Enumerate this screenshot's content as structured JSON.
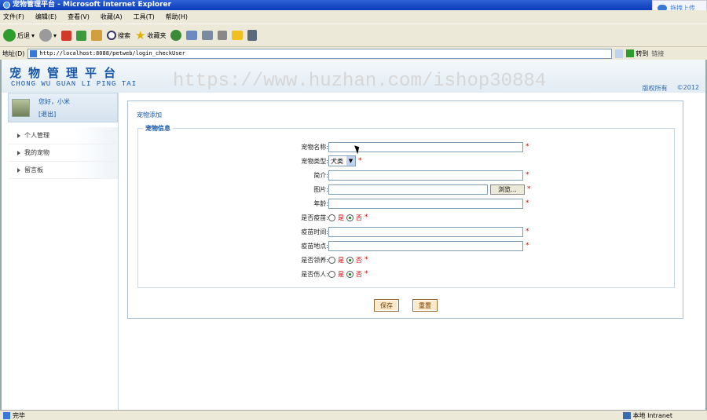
{
  "window": {
    "title": "宠物管理平台 - Microsoft Internet Explorer",
    "status": "完毕",
    "zone": "本地 Intranet"
  },
  "menu": [
    "文件(F)",
    "编辑(E)",
    "查看(V)",
    "收藏(A)",
    "工具(T)",
    "帮助(H)"
  ],
  "toolbar": {
    "back": "后退",
    "search": "搜索",
    "favorites": "收藏夹"
  },
  "address": {
    "label": "地址(D)",
    "url": "http://localhost:8088/petweb/login_checkUser",
    "go": "转到",
    "links": "链接"
  },
  "baidu": {
    "label": "拖拽上传"
  },
  "header": {
    "title": "宠物管理平台",
    "pinyin": "CHONG WU GUAN LI PING TAI",
    "watermark": "https://www.huzhan.com/ishop30884",
    "copyright": "版权所有",
    "year": "©2012"
  },
  "user": {
    "greeting": "您好，小米",
    "logout": "[退出]"
  },
  "nav": [
    "个人管理",
    "我的宠物",
    "留言板"
  ],
  "page": {
    "breadcrumb": "宠物添加",
    "legend": "宠物信息"
  },
  "form": {
    "name_label": "宠物名称:",
    "type_label": "宠物类型:",
    "type_value": "犬类",
    "intro_label": "简介:",
    "image_label": "图片:",
    "browse": "浏览...",
    "age_label": "年龄:",
    "vaccine_label": "是否疫苗:",
    "vaccine_time_label": "疫苗时间:",
    "vaccine_place_label": "疫苗地点:",
    "adopt_label": "是否领养:",
    "hurt_label": "是否伤人:",
    "yes": "是",
    "no": "否",
    "required": "*"
  },
  "buttons": {
    "save": "保存",
    "reset": "重置"
  }
}
